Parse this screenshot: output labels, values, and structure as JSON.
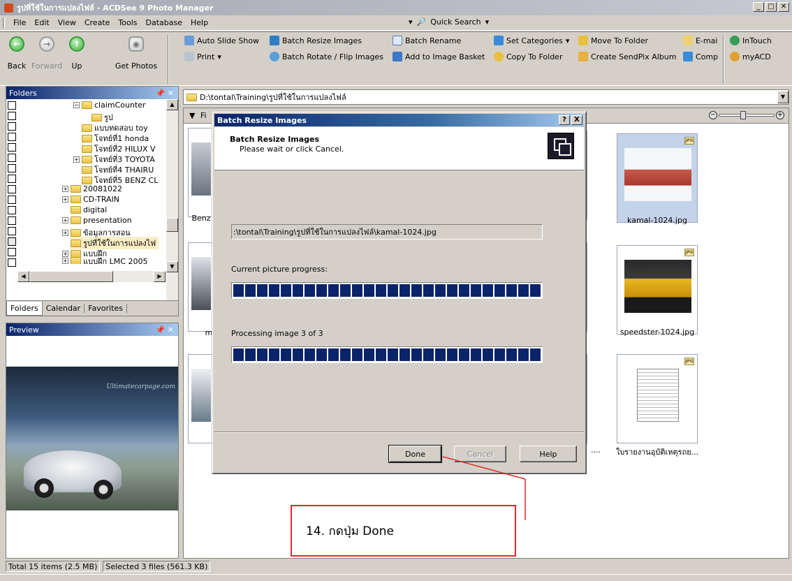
{
  "window": {
    "title": "รูปที่ใช้ในการแปลงไฟล์ - ACDSee 9 Photo Manager",
    "min": "_",
    "max": "□",
    "close": "✕"
  },
  "menubar": {
    "items": [
      "File",
      "Edit",
      "View",
      "Create",
      "Tools",
      "Database",
      "Help"
    ],
    "quick_search": "Quick Search"
  },
  "toolbar": {
    "back": "Back",
    "forward": "Forward",
    "up": "Up",
    "get_photos": "Get Photos",
    "auto_slide_show": "Auto Slide Show",
    "print": "Print",
    "batch_resize": "Batch Resize Images",
    "batch_rotate": "Batch Rotate / Flip Images",
    "batch_rename": "Batch Rename",
    "add_basket": "Add to Image Basket",
    "set_categories": "Set Categories",
    "copy_to_folder": "Copy To Folder",
    "move_to_folder": "Move To Folder",
    "sendpix": "Create SendPix Album",
    "email": "E-mai",
    "comp": "Comp",
    "intouch": "InTouch",
    "myacd": "myACD"
  },
  "folders": {
    "title": "Folders",
    "pin": "📌 ✕",
    "items": [
      "claimCounter",
      "รูป",
      "แบบทดสอบ toy",
      "โจทย์ที่1 honda",
      "โจทย์ที่2 HILUX V",
      "โจทย์ที่3 TOYOTA",
      "โจทย์ที่4 THAIRU",
      "โจทย์ที่5 BENZ CL",
      "20081022",
      "CD-TRAIN",
      "digital",
      "presentation",
      "ข้อมูลการสอน",
      "รูปที่ใช้ในการแปลงไฟ",
      "แบบฝึก",
      "แบบฝึก LMC 2005"
    ],
    "tabs": [
      "Folders",
      "Calendar",
      "Favorites"
    ]
  },
  "preview": {
    "title": "Preview",
    "watermark": "Ultimatecarpage.com"
  },
  "address": {
    "path": "D:\\tontal\\Training\\รูปที่ใช้ในการแปลงไฟล์"
  },
  "files": {
    "filter_label": "Fi",
    "thumbs": [
      {
        "label": "kamal-1024.jpg"
      },
      {
        "label": "speedster-1024.jpg"
      },
      {
        "label": "ใบรายงานอุบัติเหตุรถย..."
      },
      {
        "label": "Benz"
      },
      {
        "label": "m"
      },
      {
        "label": "...."
      }
    ]
  },
  "dialog": {
    "title": "Batch Resize Images",
    "help": "?",
    "close": "X",
    "heading": "Batch Resize Images",
    "subheading": "Please wait or click Cancel.",
    "current_file": ":\\tontal\\Training\\รูปที่ใช้ในการแปลงไฟล์\\kamal-1024.jpg",
    "current_progress_label": "Current picture progress:",
    "current_progress": 1.0,
    "processing_label": "Processing image 3 of 3",
    "processing_progress": 1.0,
    "done": "Done",
    "cancel": "Cancel",
    "helpbtn": "Help"
  },
  "status": {
    "total": "Total 15 items (2.5 MB)",
    "selected": "Selected 3 files (561.3 KB)"
  },
  "callout": {
    "text": "14. กดปุ่ม Done"
  },
  "colors": {
    "accent": "#0a246a",
    "callout_border": "#e02a2a"
  }
}
